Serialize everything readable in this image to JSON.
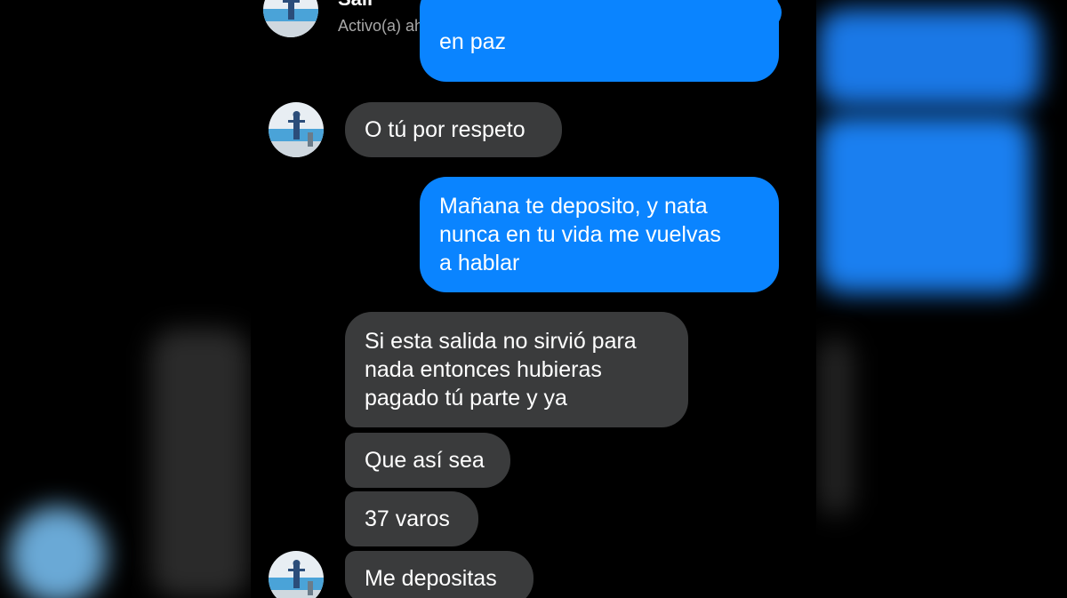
{
  "header": {
    "contact_name": "Sair",
    "status": "Activo(a) ahora",
    "accent": "#0a84ff"
  },
  "icons": {
    "call": "phone-icon",
    "video": "video-camera-icon",
    "info": "info-icon"
  },
  "messages": [
    {
      "direction": "outgoing",
      "lines": [
        "en paz"
      ]
    },
    {
      "direction": "incoming",
      "lines": [
        "O tú por respeto"
      ]
    },
    {
      "direction": "outgoing",
      "lines": [
        "Mañana te deposito, y nata",
        "nunca en tu vida me vuelvas",
        "a hablar"
      ]
    },
    {
      "direction": "incoming",
      "lines": [
        "Si esta salida no sirvió para",
        "nada entonces hubieras",
        "pagado tú parte y ya"
      ]
    },
    {
      "direction": "incoming",
      "lines": [
        "Que así sea"
      ]
    },
    {
      "direction": "incoming",
      "lines": [
        "37 varos"
      ]
    },
    {
      "direction": "incoming",
      "lines": [
        "Me depositas"
      ]
    }
  ],
  "colors": {
    "incoming_bubble": "#3a3b3c",
    "outgoing_bubble": "#0a84ff",
    "background": "#000000"
  }
}
